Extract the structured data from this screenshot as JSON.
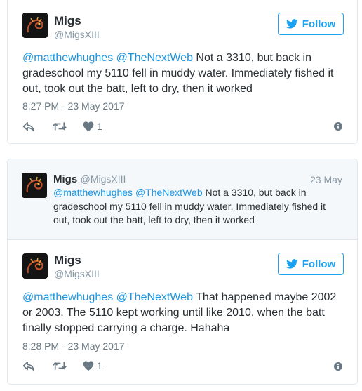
{
  "tweet1": {
    "name": "Migs",
    "handle": "@MigsXIII",
    "follow_label": "Follow",
    "mention1": "@matthewhughes",
    "mention2": "@TheNextWeb",
    "body_line1": " Not a 3310, but back in",
    "body_line2": "gradeschool my 5110 fell in muddy water. Immediately fished it",
    "body_line3": "out, took out the batt, left to dry, then it worked",
    "timestamp": "8:27 PM - 23 May 2017",
    "like_count": "1"
  },
  "quoted": {
    "name": "Migs",
    "handle": "@MigsXIII",
    "date": "23 May",
    "mention1": "@matthewhughes",
    "mention2": "@TheNextWeb",
    "body_line1": " Not a 3310, but back in",
    "body_line2": "gradeschool my 5110 fell in muddy water. Immediately fished it",
    "body_line3": "out, took out the batt, left to dry, then it worked"
  },
  "tweet2": {
    "name": "Migs",
    "handle": "@MigsXIII",
    "follow_label": "Follow",
    "mention1": "@matthewhughes",
    "mention2": "@TheNextWeb",
    "body_line1": " That happened maybe 2002",
    "body_line2": "or 2003. The 5110 kept working until like 2010, when the batt",
    "body_line3": "finally stopped carrying a charge. Hahaha",
    "timestamp": "8:28 PM - 23 May 2017",
    "like_count": "1"
  },
  "icons": {
    "follow": "twitter-bird-icon",
    "reply": "reply-icon",
    "retweet": "retweet-icon",
    "like": "heart-icon",
    "info": "info-icon"
  },
  "colors": {
    "accent": "#1da1f2",
    "mention": "#1b95e0",
    "muted": "#697882",
    "quote_bg": "#f5f8fa"
  }
}
